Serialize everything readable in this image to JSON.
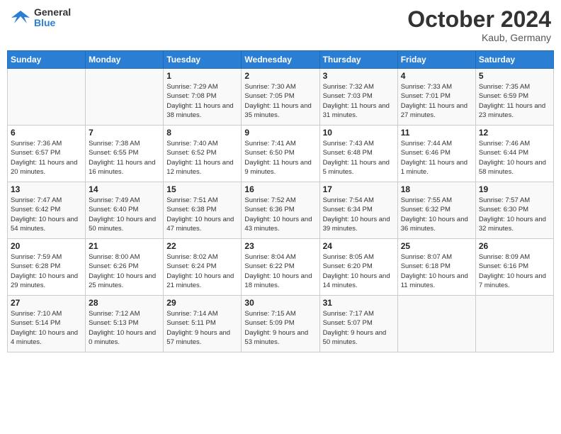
{
  "header": {
    "logo": {
      "line1": "General",
      "line2": "Blue"
    },
    "month_year": "October 2024",
    "location": "Kaub, Germany"
  },
  "days_of_week": [
    "Sunday",
    "Monday",
    "Tuesday",
    "Wednesday",
    "Thursday",
    "Friday",
    "Saturday"
  ],
  "weeks": [
    [
      {
        "day": "",
        "sunrise": "",
        "sunset": "",
        "daylight": ""
      },
      {
        "day": "",
        "sunrise": "",
        "sunset": "",
        "daylight": ""
      },
      {
        "day": "1",
        "sunrise": "Sunrise: 7:29 AM",
        "sunset": "Sunset: 7:08 PM",
        "daylight": "Daylight: 11 hours and 38 minutes."
      },
      {
        "day": "2",
        "sunrise": "Sunrise: 7:30 AM",
        "sunset": "Sunset: 7:05 PM",
        "daylight": "Daylight: 11 hours and 35 minutes."
      },
      {
        "day": "3",
        "sunrise": "Sunrise: 7:32 AM",
        "sunset": "Sunset: 7:03 PM",
        "daylight": "Daylight: 11 hours and 31 minutes."
      },
      {
        "day": "4",
        "sunrise": "Sunrise: 7:33 AM",
        "sunset": "Sunset: 7:01 PM",
        "daylight": "Daylight: 11 hours and 27 minutes."
      },
      {
        "day": "5",
        "sunrise": "Sunrise: 7:35 AM",
        "sunset": "Sunset: 6:59 PM",
        "daylight": "Daylight: 11 hours and 23 minutes."
      }
    ],
    [
      {
        "day": "6",
        "sunrise": "Sunrise: 7:36 AM",
        "sunset": "Sunset: 6:57 PM",
        "daylight": "Daylight: 11 hours and 20 minutes."
      },
      {
        "day": "7",
        "sunrise": "Sunrise: 7:38 AM",
        "sunset": "Sunset: 6:55 PM",
        "daylight": "Daylight: 11 hours and 16 minutes."
      },
      {
        "day": "8",
        "sunrise": "Sunrise: 7:40 AM",
        "sunset": "Sunset: 6:52 PM",
        "daylight": "Daylight: 11 hours and 12 minutes."
      },
      {
        "day": "9",
        "sunrise": "Sunrise: 7:41 AM",
        "sunset": "Sunset: 6:50 PM",
        "daylight": "Daylight: 11 hours and 9 minutes."
      },
      {
        "day": "10",
        "sunrise": "Sunrise: 7:43 AM",
        "sunset": "Sunset: 6:48 PM",
        "daylight": "Daylight: 11 hours and 5 minutes."
      },
      {
        "day": "11",
        "sunrise": "Sunrise: 7:44 AM",
        "sunset": "Sunset: 6:46 PM",
        "daylight": "Daylight: 11 hours and 1 minute."
      },
      {
        "day": "12",
        "sunrise": "Sunrise: 7:46 AM",
        "sunset": "Sunset: 6:44 PM",
        "daylight": "Daylight: 10 hours and 58 minutes."
      }
    ],
    [
      {
        "day": "13",
        "sunrise": "Sunrise: 7:47 AM",
        "sunset": "Sunset: 6:42 PM",
        "daylight": "Daylight: 10 hours and 54 minutes."
      },
      {
        "day": "14",
        "sunrise": "Sunrise: 7:49 AM",
        "sunset": "Sunset: 6:40 PM",
        "daylight": "Daylight: 10 hours and 50 minutes."
      },
      {
        "day": "15",
        "sunrise": "Sunrise: 7:51 AM",
        "sunset": "Sunset: 6:38 PM",
        "daylight": "Daylight: 10 hours and 47 minutes."
      },
      {
        "day": "16",
        "sunrise": "Sunrise: 7:52 AM",
        "sunset": "Sunset: 6:36 PM",
        "daylight": "Daylight: 10 hours and 43 minutes."
      },
      {
        "day": "17",
        "sunrise": "Sunrise: 7:54 AM",
        "sunset": "Sunset: 6:34 PM",
        "daylight": "Daylight: 10 hours and 39 minutes."
      },
      {
        "day": "18",
        "sunrise": "Sunrise: 7:55 AM",
        "sunset": "Sunset: 6:32 PM",
        "daylight": "Daylight: 10 hours and 36 minutes."
      },
      {
        "day": "19",
        "sunrise": "Sunrise: 7:57 AM",
        "sunset": "Sunset: 6:30 PM",
        "daylight": "Daylight: 10 hours and 32 minutes."
      }
    ],
    [
      {
        "day": "20",
        "sunrise": "Sunrise: 7:59 AM",
        "sunset": "Sunset: 6:28 PM",
        "daylight": "Daylight: 10 hours and 29 minutes."
      },
      {
        "day": "21",
        "sunrise": "Sunrise: 8:00 AM",
        "sunset": "Sunset: 6:26 PM",
        "daylight": "Daylight: 10 hours and 25 minutes."
      },
      {
        "day": "22",
        "sunrise": "Sunrise: 8:02 AM",
        "sunset": "Sunset: 6:24 PM",
        "daylight": "Daylight: 10 hours and 21 minutes."
      },
      {
        "day": "23",
        "sunrise": "Sunrise: 8:04 AM",
        "sunset": "Sunset: 6:22 PM",
        "daylight": "Daylight: 10 hours and 18 minutes."
      },
      {
        "day": "24",
        "sunrise": "Sunrise: 8:05 AM",
        "sunset": "Sunset: 6:20 PM",
        "daylight": "Daylight: 10 hours and 14 minutes."
      },
      {
        "day": "25",
        "sunrise": "Sunrise: 8:07 AM",
        "sunset": "Sunset: 6:18 PM",
        "daylight": "Daylight: 10 hours and 11 minutes."
      },
      {
        "day": "26",
        "sunrise": "Sunrise: 8:09 AM",
        "sunset": "Sunset: 6:16 PM",
        "daylight": "Daylight: 10 hours and 7 minutes."
      }
    ],
    [
      {
        "day": "27",
        "sunrise": "Sunrise: 7:10 AM",
        "sunset": "Sunset: 5:14 PM",
        "daylight": "Daylight: 10 hours and 4 minutes."
      },
      {
        "day": "28",
        "sunrise": "Sunrise: 7:12 AM",
        "sunset": "Sunset: 5:13 PM",
        "daylight": "Daylight: 10 hours and 0 minutes."
      },
      {
        "day": "29",
        "sunrise": "Sunrise: 7:14 AM",
        "sunset": "Sunset: 5:11 PM",
        "daylight": "Daylight: 9 hours and 57 minutes."
      },
      {
        "day": "30",
        "sunrise": "Sunrise: 7:15 AM",
        "sunset": "Sunset: 5:09 PM",
        "daylight": "Daylight: 9 hours and 53 minutes."
      },
      {
        "day": "31",
        "sunrise": "Sunrise: 7:17 AM",
        "sunset": "Sunset: 5:07 PM",
        "daylight": "Daylight: 9 hours and 50 minutes."
      },
      {
        "day": "",
        "sunrise": "",
        "sunset": "",
        "daylight": ""
      },
      {
        "day": "",
        "sunrise": "",
        "sunset": "",
        "daylight": ""
      }
    ]
  ]
}
